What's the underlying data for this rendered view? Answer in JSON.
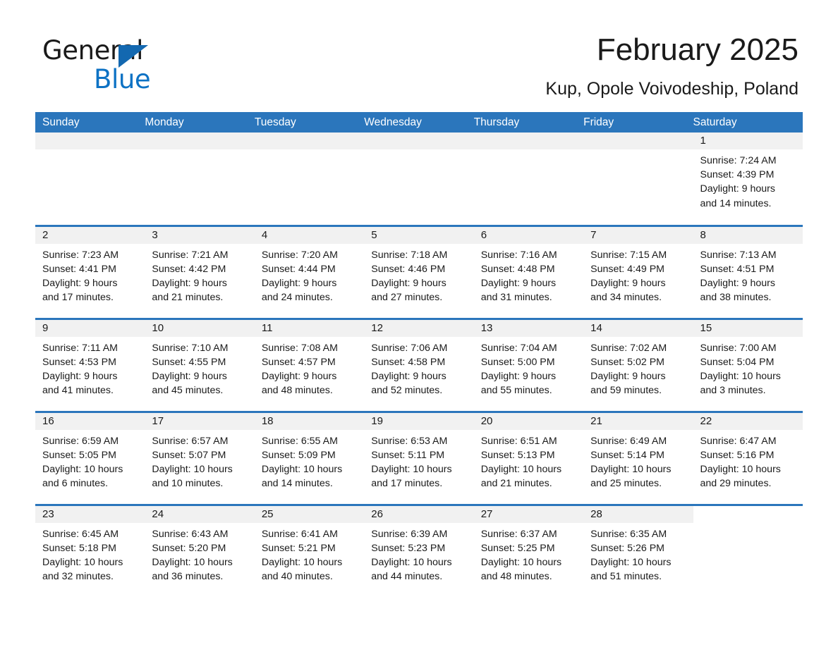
{
  "brand": {
    "name_part1": "General",
    "name_part2": "Blue",
    "triangle_color": "#1368b0",
    "blue_text_color": "#0d72c4"
  },
  "header": {
    "title": "February 2025",
    "location": "Kup, Opole Voivodeship, Poland"
  },
  "theme": {
    "header_band": "#2b76bc",
    "daynum_band": "#f1f1f1",
    "text": "#1a1a1a"
  },
  "calendar": {
    "weekday_headers": [
      "Sunday",
      "Monday",
      "Tuesday",
      "Wednesday",
      "Thursday",
      "Friday",
      "Saturday"
    ],
    "weeks": [
      [
        {
          "day": "",
          "lines": [],
          "state": "blank-shaded"
        },
        {
          "day": "",
          "lines": [],
          "state": "blank-shaded"
        },
        {
          "day": "",
          "lines": [],
          "state": "blank-shaded"
        },
        {
          "day": "",
          "lines": [],
          "state": "blank-shaded"
        },
        {
          "day": "",
          "lines": [],
          "state": "blank-shaded"
        },
        {
          "day": "",
          "lines": [],
          "state": "blank-shaded"
        },
        {
          "day": "1",
          "state": "filled",
          "lines": [
            "Sunrise: 7:24 AM",
            "Sunset: 4:39 PM",
            "Daylight: 9 hours",
            "and 14 minutes."
          ]
        }
      ],
      [
        {
          "day": "2",
          "state": "filled",
          "lines": [
            "Sunrise: 7:23 AM",
            "Sunset: 4:41 PM",
            "Daylight: 9 hours",
            "and 17 minutes."
          ]
        },
        {
          "day": "3",
          "state": "filled",
          "lines": [
            "Sunrise: 7:21 AM",
            "Sunset: 4:42 PM",
            "Daylight: 9 hours",
            "and 21 minutes."
          ]
        },
        {
          "day": "4",
          "state": "filled",
          "lines": [
            "Sunrise: 7:20 AM",
            "Sunset: 4:44 PM",
            "Daylight: 9 hours",
            "and 24 minutes."
          ]
        },
        {
          "day": "5",
          "state": "filled",
          "lines": [
            "Sunrise: 7:18 AM",
            "Sunset: 4:46 PM",
            "Daylight: 9 hours",
            "and 27 minutes."
          ]
        },
        {
          "day": "6",
          "state": "filled",
          "lines": [
            "Sunrise: 7:16 AM",
            "Sunset: 4:48 PM",
            "Daylight: 9 hours",
            "and 31 minutes."
          ]
        },
        {
          "day": "7",
          "state": "filled",
          "lines": [
            "Sunrise: 7:15 AM",
            "Sunset: 4:49 PM",
            "Daylight: 9 hours",
            "and 34 minutes."
          ]
        },
        {
          "day": "8",
          "state": "filled",
          "lines": [
            "Sunrise: 7:13 AM",
            "Sunset: 4:51 PM",
            "Daylight: 9 hours",
            "and 38 minutes."
          ]
        }
      ],
      [
        {
          "day": "9",
          "state": "filled",
          "lines": [
            "Sunrise: 7:11 AM",
            "Sunset: 4:53 PM",
            "Daylight: 9 hours",
            "and 41 minutes."
          ]
        },
        {
          "day": "10",
          "state": "filled",
          "lines": [
            "Sunrise: 7:10 AM",
            "Sunset: 4:55 PM",
            "Daylight: 9 hours",
            "and 45 minutes."
          ]
        },
        {
          "day": "11",
          "state": "filled",
          "lines": [
            "Sunrise: 7:08 AM",
            "Sunset: 4:57 PM",
            "Daylight: 9 hours",
            "and 48 minutes."
          ]
        },
        {
          "day": "12",
          "state": "filled",
          "lines": [
            "Sunrise: 7:06 AM",
            "Sunset: 4:58 PM",
            "Daylight: 9 hours",
            "and 52 minutes."
          ]
        },
        {
          "day": "13",
          "state": "filled",
          "lines": [
            "Sunrise: 7:04 AM",
            "Sunset: 5:00 PM",
            "Daylight: 9 hours",
            "and 55 minutes."
          ]
        },
        {
          "day": "14",
          "state": "filled",
          "lines": [
            "Sunrise: 7:02 AM",
            "Sunset: 5:02 PM",
            "Daylight: 9 hours",
            "and 59 minutes."
          ]
        },
        {
          "day": "15",
          "state": "filled",
          "lines": [
            "Sunrise: 7:00 AM",
            "Sunset: 5:04 PM",
            "Daylight: 10 hours",
            "and 3 minutes."
          ]
        }
      ],
      [
        {
          "day": "16",
          "state": "filled",
          "lines": [
            "Sunrise: 6:59 AM",
            "Sunset: 5:05 PM",
            "Daylight: 10 hours",
            "and 6 minutes."
          ]
        },
        {
          "day": "17",
          "state": "filled",
          "lines": [
            "Sunrise: 6:57 AM",
            "Sunset: 5:07 PM",
            "Daylight: 10 hours",
            "and 10 minutes."
          ]
        },
        {
          "day": "18",
          "state": "filled",
          "lines": [
            "Sunrise: 6:55 AM",
            "Sunset: 5:09 PM",
            "Daylight: 10 hours",
            "and 14 minutes."
          ]
        },
        {
          "day": "19",
          "state": "filled",
          "lines": [
            "Sunrise: 6:53 AM",
            "Sunset: 5:11 PM",
            "Daylight: 10 hours",
            "and 17 minutes."
          ]
        },
        {
          "day": "20",
          "state": "filled",
          "lines": [
            "Sunrise: 6:51 AM",
            "Sunset: 5:13 PM",
            "Daylight: 10 hours",
            "and 21 minutes."
          ]
        },
        {
          "day": "21",
          "state": "filled",
          "lines": [
            "Sunrise: 6:49 AM",
            "Sunset: 5:14 PM",
            "Daylight: 10 hours",
            "and 25 minutes."
          ]
        },
        {
          "day": "22",
          "state": "filled",
          "lines": [
            "Sunrise: 6:47 AM",
            "Sunset: 5:16 PM",
            "Daylight: 10 hours",
            "and 29 minutes."
          ]
        }
      ],
      [
        {
          "day": "23",
          "state": "filled",
          "lines": [
            "Sunrise: 6:45 AM",
            "Sunset: 5:18 PM",
            "Daylight: 10 hours",
            "and 32 minutes."
          ]
        },
        {
          "day": "24",
          "state": "filled",
          "lines": [
            "Sunrise: 6:43 AM",
            "Sunset: 5:20 PM",
            "Daylight: 10 hours",
            "and 36 minutes."
          ]
        },
        {
          "day": "25",
          "state": "filled",
          "lines": [
            "Sunrise: 6:41 AM",
            "Sunset: 5:21 PM",
            "Daylight: 10 hours",
            "and 40 minutes."
          ]
        },
        {
          "day": "26",
          "state": "filled",
          "lines": [
            "Sunrise: 6:39 AM",
            "Sunset: 5:23 PM",
            "Daylight: 10 hours",
            "and 44 minutes."
          ]
        },
        {
          "day": "27",
          "state": "filled",
          "lines": [
            "Sunrise: 6:37 AM",
            "Sunset: 5:25 PM",
            "Daylight: 10 hours",
            "and 48 minutes."
          ]
        },
        {
          "day": "28",
          "state": "filled",
          "lines": [
            "Sunrise: 6:35 AM",
            "Sunset: 5:26 PM",
            "Daylight: 10 hours",
            "and 51 minutes."
          ]
        },
        {
          "day": "",
          "state": "blank",
          "lines": []
        }
      ]
    ]
  }
}
